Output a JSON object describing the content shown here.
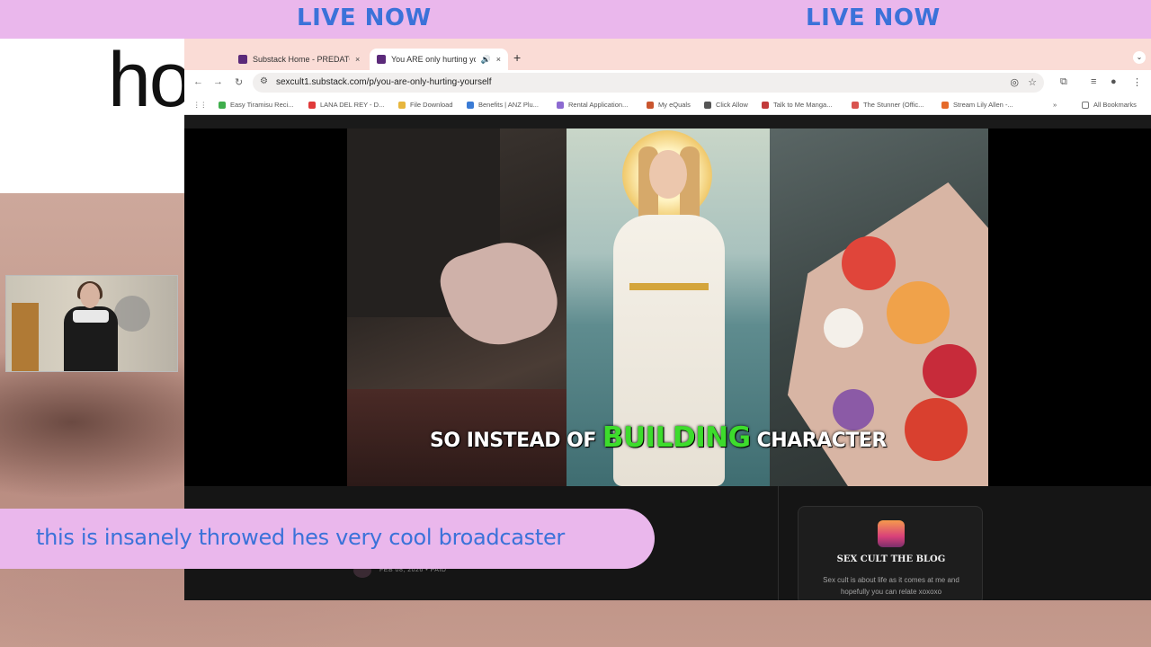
{
  "banner": {
    "left_text": "LIVE NOW",
    "right_text": "LIVE NOW"
  },
  "background": {
    "big_text": "ho"
  },
  "browser": {
    "tabs": [
      {
        "title": "Substack Home - PREDATOR",
        "close": "×"
      },
      {
        "title": "You ARE only hurting you",
        "audio": "🔊",
        "close": "×"
      }
    ],
    "new_tab": "+",
    "tab_menu": "⌄",
    "url": "sexcult1.substack.com/p/you-are-only-hurting-yourself",
    "bookmarks": [
      {
        "label": "Easy Tiramisu Reci...",
        "color": "#3fae4c"
      },
      {
        "label": "LANA DEL REY - D...",
        "color": "#e03a3a"
      },
      {
        "label": "File Download",
        "color": "#e7b63d"
      },
      {
        "label": "Benefits | ANZ Plu...",
        "color": "#3a7bd5"
      },
      {
        "label": "Rental Application...",
        "color": "#8c6ad1"
      },
      {
        "label": "My eQuals",
        "color": "#c9552e"
      },
      {
        "label": "Click Allow",
        "color": "#555555"
      },
      {
        "label": "Talk to Me Manga...",
        "color": "#c23a3a"
      },
      {
        "label": "The Stunner (Offic...",
        "color": "#d9534f"
      },
      {
        "label": "Stream Lily Allen -...",
        "color": "#e56a2a"
      }
    ],
    "all_bookmarks": "All Bookmarks"
  },
  "video": {
    "caption_before": "SO INSTEAD OF",
    "caption_highlight": "BUILDING",
    "caption_after": "CHARACTER"
  },
  "post": {
    "meta": "FEB 08, 2026 • PAID"
  },
  "blog_card": {
    "name": "SEX CULT THE BLOG",
    "description": "Sex cult is about life as it comes at me and hopefully you can relate xoxoxo"
  },
  "chat": {
    "message": "this is insanely throwed hes very cool broadcaster"
  },
  "colors": {
    "banner_bg": "#eab7ec",
    "banner_text": "#3b72d9",
    "caption_highlight": "#3ddc2c"
  }
}
